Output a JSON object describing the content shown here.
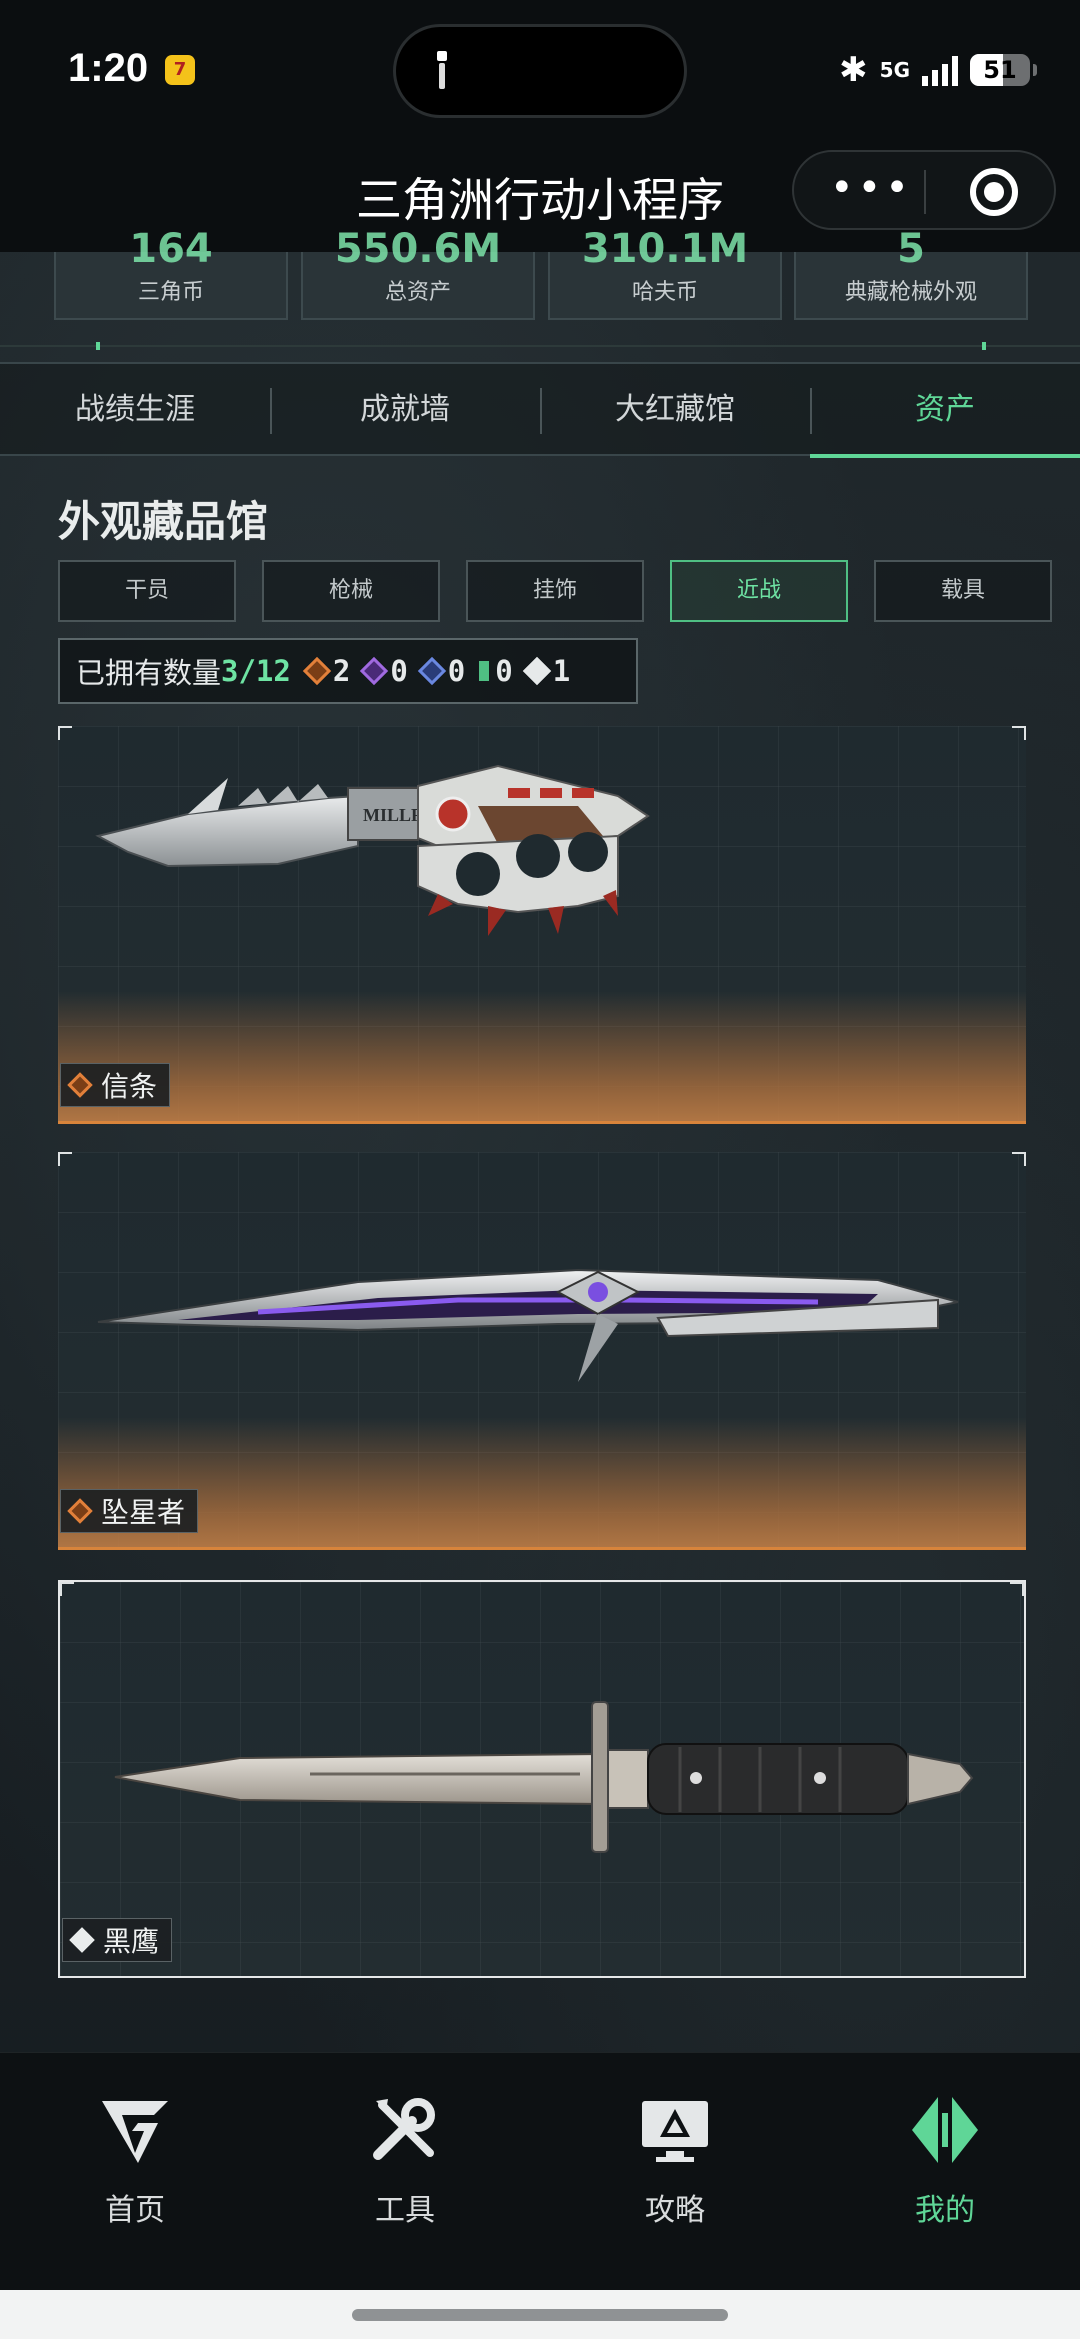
{
  "status_bar": {
    "time": "1:20",
    "network": "5G",
    "battery": "51"
  },
  "navbar": {
    "title": "三角洲行动小程序",
    "more": "•••"
  },
  "stats": [
    {
      "value": "164",
      "label": "三角币"
    },
    {
      "value": "550.6M",
      "label": "总资产"
    },
    {
      "value": "310.1M",
      "label": "哈夫币"
    },
    {
      "value": "5",
      "label": "典藏枪械外观"
    }
  ],
  "tabs": [
    {
      "label": "战绩生涯",
      "active": false
    },
    {
      "label": "成就墙",
      "active": false
    },
    {
      "label": "大红藏馆",
      "active": false
    },
    {
      "label": "资产",
      "active": true
    }
  ],
  "section_title": "外观藏品馆",
  "filters": [
    {
      "label": "干员",
      "active": false
    },
    {
      "label": "枪械",
      "active": false
    },
    {
      "label": "挂饰",
      "active": false
    },
    {
      "label": "近战",
      "active": true
    },
    {
      "label": "载具",
      "active": false
    }
  ],
  "owned": {
    "label": "已拥有数量",
    "count": "3/12",
    "rarities": [
      {
        "count": "2",
        "color": "#e2803a"
      },
      {
        "count": "0",
        "color": "#a06ae0"
      },
      {
        "count": "0",
        "color": "#6a88e0"
      },
      {
        "count": "0",
        "color": "#4fbf83"
      },
      {
        "count": "1",
        "color": "#e6e9ea"
      }
    ]
  },
  "items": [
    {
      "name": "信条",
      "rarity": "orange",
      "brand": "MILLFIELD"
    },
    {
      "name": "坠星者",
      "rarity": "orange",
      "brand": ""
    },
    {
      "name": "黑鹰",
      "rarity": "white",
      "brand": ""
    }
  ],
  "bottom_nav": [
    {
      "label": "首页",
      "icon": "home-logo-icon",
      "active": false
    },
    {
      "label": "工具",
      "icon": "tools-icon",
      "active": false
    },
    {
      "label": "攻略",
      "icon": "guide-monitor-icon",
      "active": false
    },
    {
      "label": "我的",
      "icon": "profile-logo-icon",
      "active": true
    }
  ],
  "colors": {
    "accent": "#5fd697",
    "orange_rarity": "#e2803a"
  }
}
